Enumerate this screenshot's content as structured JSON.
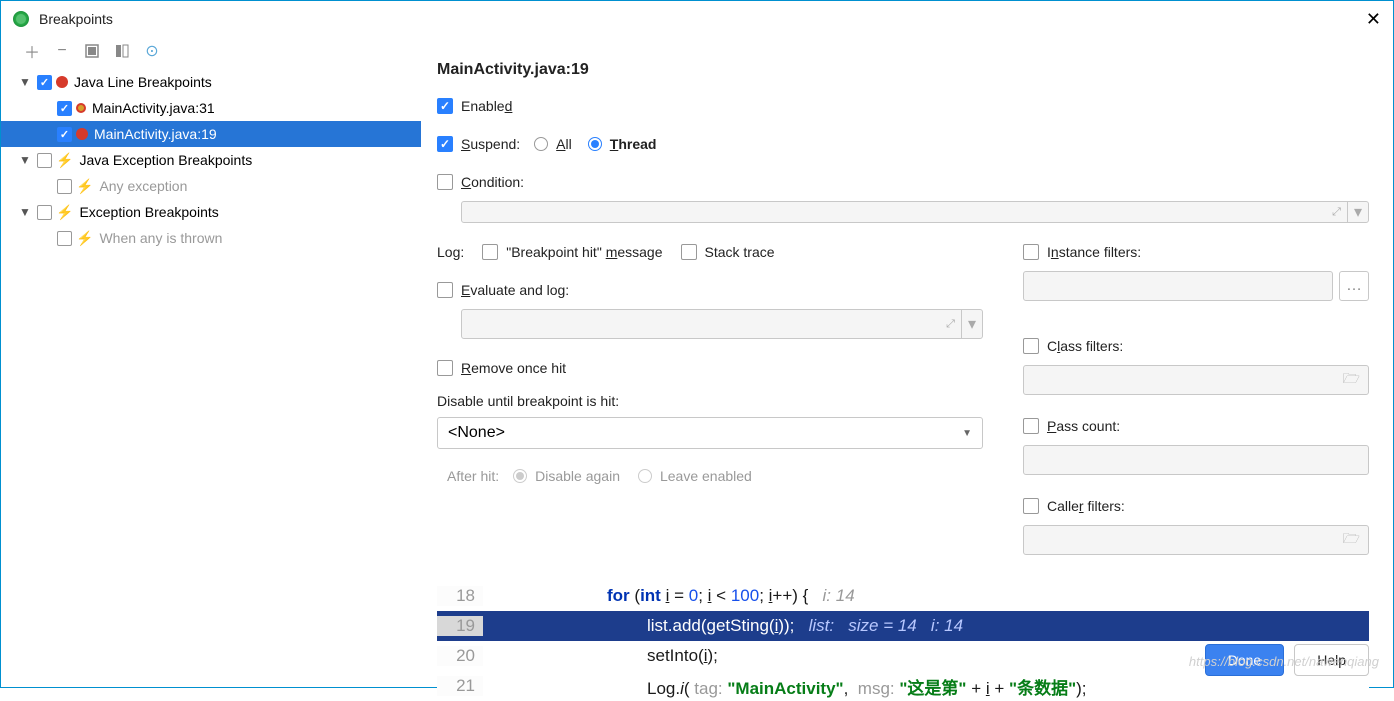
{
  "window": {
    "title": "Breakpoints"
  },
  "tree": {
    "group1": "Java Line Breakpoints",
    "item1a": "MainActivity.java:31",
    "item1b": "MainActivity.java:19",
    "group2": "Java Exception Breakpoints",
    "item2a": "Any exception",
    "group3": "Exception Breakpoints",
    "item3a": "When any is thrown"
  },
  "details": {
    "title": "MainActivity.java:19",
    "enabled": "Enabled",
    "suspend": "Suspend:",
    "all": "All",
    "thread": "Thread",
    "condition": "Condition:",
    "log": "Log:",
    "bp_hit_msg": "\"Breakpoint hit\" message",
    "stack_trace": "Stack trace",
    "eval_log": "Evaluate and log:",
    "remove_once": "Remove once hit",
    "disable_until": "Disable until breakpoint is hit:",
    "none": "<None>",
    "after_hit": "After hit:",
    "disable_again": "Disable again",
    "leave_enabled": "Leave enabled",
    "instance_filters": "Instance filters:",
    "class_filters": "Class filters:",
    "pass_count": "Pass count:",
    "caller_filters": "Caller filters:"
  },
  "code": {
    "l18": {
      "n": "18",
      "text_a": "for",
      "text_b": " (",
      "text_c": "int",
      "text_d": " i = ",
      "text_e": "0",
      "text_f": "; i < ",
      "text_g": "100",
      "text_h": "; i++) {   ",
      "hint": "i: 14"
    },
    "l19": {
      "n": "19",
      "text": "list.add(getSting(i));   ",
      "hint": "list:   size = 14   i: 14"
    },
    "l20": {
      "n": "20",
      "text": "setInto(i);"
    },
    "l21": {
      "n": "21",
      "text_a": "Log.",
      "text_b": "i",
      "text_c": "( ",
      "tag_lbl": "tag: ",
      "tag": "\"MainActivity\"",
      "text_d": ",  ",
      "msg_lbl": "msg: ",
      "msg1": "\"这是第\"",
      "text_e": " + i + ",
      "msg2": "\"条数据\"",
      "text_f": ");"
    }
  },
  "footer": {
    "done": "Done",
    "help": "Help"
  },
  "watermark": "https://blog.csdn.net/nawenqiang"
}
